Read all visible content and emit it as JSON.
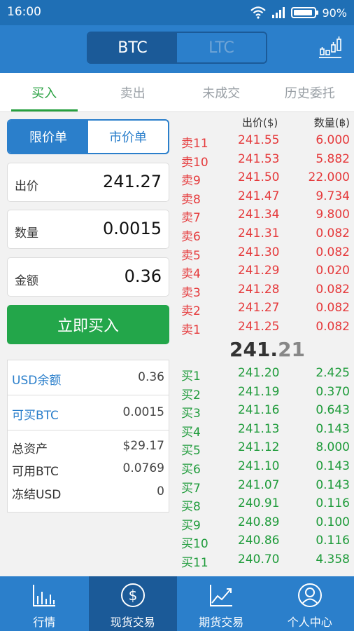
{
  "status_bar": {
    "time": "16:00",
    "battery": "90%",
    "battery_level": 0.9
  },
  "header": {
    "segments": [
      "BTC",
      "LTC"
    ],
    "active_segment": "BTC",
    "chart_icon": "candlestick-chart-icon"
  },
  "tabs": [
    {
      "label": "买入",
      "active": true
    },
    {
      "label": "卖出",
      "active": false
    },
    {
      "label": "未成交",
      "active": false
    },
    {
      "label": "历史委托",
      "active": false
    }
  ],
  "order_type": {
    "options": [
      "限价单",
      "市价单"
    ],
    "active": "限价单"
  },
  "form": {
    "price": {
      "label": "出价",
      "value": "241.27"
    },
    "amount": {
      "label": "数量",
      "value": "0.0015"
    },
    "total": {
      "label": "金额",
      "value": "0.36"
    },
    "submit_label": "立即买入"
  },
  "balance": {
    "usd_balance": {
      "label": "USD余额",
      "value": "0.36"
    },
    "buyable_btc": {
      "label": "可买BTC",
      "value": "0.0015"
    },
    "total_assets": {
      "label": "总资产",
      "value": "$29.17"
    },
    "available_btc": {
      "label": "可用BTC",
      "value": "0.0769"
    },
    "frozen_usd": {
      "label": "冻结USD",
      "value": "0"
    }
  },
  "order_book": {
    "headers": {
      "price": "出价($)",
      "quantity": "数量(฿)"
    },
    "asks": [
      {
        "name": "卖11",
        "price": "241.55",
        "qty": "6.000"
      },
      {
        "name": "卖10",
        "price": "241.53",
        "qty": "5.882"
      },
      {
        "name": "卖9",
        "price": "241.50",
        "qty": "22.000"
      },
      {
        "name": "卖8",
        "price": "241.47",
        "qty": "9.734"
      },
      {
        "name": "卖7",
        "price": "241.34",
        "qty": "9.800"
      },
      {
        "name": "卖6",
        "price": "241.31",
        "qty": "0.082"
      },
      {
        "name": "卖5",
        "price": "241.30",
        "qty": "0.082"
      },
      {
        "name": "卖4",
        "price": "241.29",
        "qty": "0.020"
      },
      {
        "name": "卖3",
        "price": "241.28",
        "qty": "0.082"
      },
      {
        "name": "卖2",
        "price": "241.27",
        "qty": "0.082"
      },
      {
        "name": "卖1",
        "price": "241.25",
        "qty": "0.082"
      }
    ],
    "last_price": {
      "int": "241.",
      "dec": "21"
    },
    "bids": [
      {
        "name": "买1",
        "price": "241.20",
        "qty": "2.425"
      },
      {
        "name": "买2",
        "price": "241.19",
        "qty": "0.370"
      },
      {
        "name": "买3",
        "price": "241.16",
        "qty": "0.643"
      },
      {
        "name": "买4",
        "price": "241.13",
        "qty": "0.143"
      },
      {
        "name": "买5",
        "price": "241.12",
        "qty": "8.000"
      },
      {
        "name": "买6",
        "price": "241.10",
        "qty": "0.143"
      },
      {
        "name": "买7",
        "price": "241.07",
        "qty": "0.143"
      },
      {
        "name": "买8",
        "price": "240.91",
        "qty": "0.116"
      },
      {
        "name": "买9",
        "price": "240.89",
        "qty": "0.100"
      },
      {
        "name": "买10",
        "price": "240.86",
        "qty": "0.116"
      },
      {
        "name": "买11",
        "price": "240.70",
        "qty": "4.358"
      }
    ]
  },
  "bottom_nav": [
    {
      "label": "行情",
      "icon": "bar-chart-icon",
      "active": false
    },
    {
      "label": "现货交易",
      "icon": "dollar-circle-icon",
      "active": true
    },
    {
      "label": "期货交易",
      "icon": "trend-chart-icon",
      "active": false
    },
    {
      "label": "个人中心",
      "icon": "user-circle-icon",
      "active": false
    }
  ],
  "colors": {
    "primary": "#2b7fcb",
    "dark": "#1b5a98",
    "buy": "#23a64a",
    "sell": "#e5393b"
  }
}
